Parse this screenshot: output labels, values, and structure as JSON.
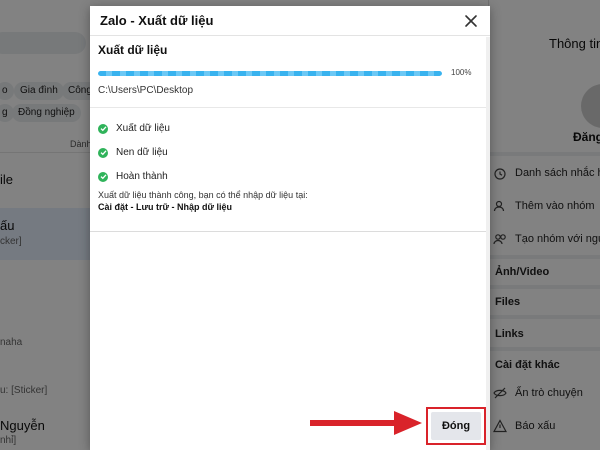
{
  "background": {
    "left": {
      "chips_row1": [
        "o",
        "Gia đình",
        "Công"
      ],
      "chips_row2": [
        "g",
        "Đồng nghiệp"
      ],
      "sort_hint": "Dành",
      "conversations": [
        {
          "name": "ile",
          "sub": ""
        },
        {
          "name": "ấu",
          "sub": "cker]"
        },
        {
          "name": "",
          "sub": "naha"
        },
        {
          "name": "",
          "sub": "u: [Sticker]"
        },
        {
          "name": "Nguyễn",
          "sub": "nhỉ]"
        }
      ]
    },
    "right": {
      "title": "Thông tin",
      "name": "Đăng",
      "actions": [
        "Danh sách nhắc hẹ",
        "Thêm vào nhóm",
        "Tạo nhóm với ngư"
      ],
      "sections": [
        "Ảnh/Video",
        "Files",
        "Links",
        "Cài đặt khác"
      ],
      "bottom_actions": [
        "Ẩn trò chuyện",
        "Báo xấu"
      ]
    }
  },
  "dialog": {
    "title": "Zalo - Xuất dữ liệu",
    "section_title": "Xuất dữ liệu",
    "progress_percent": 100,
    "progress_label": "100%",
    "path": "C:\\Users\\PC\\Desktop",
    "steps": [
      "Xuất dữ liệu",
      "Nen dữ liệu",
      "Hoàn thành"
    ],
    "result_text": "Xuất dữ liệu thành công, bạn có thể nhập dữ liệu tại:",
    "result_path": "Cài đặt - Lưu trữ - Nhập dữ liệu",
    "close_button": "Đóng"
  },
  "colors": {
    "accent_check": "#2fb35a",
    "progress": "#38b3ef",
    "annotation_red": "#d9232a"
  }
}
